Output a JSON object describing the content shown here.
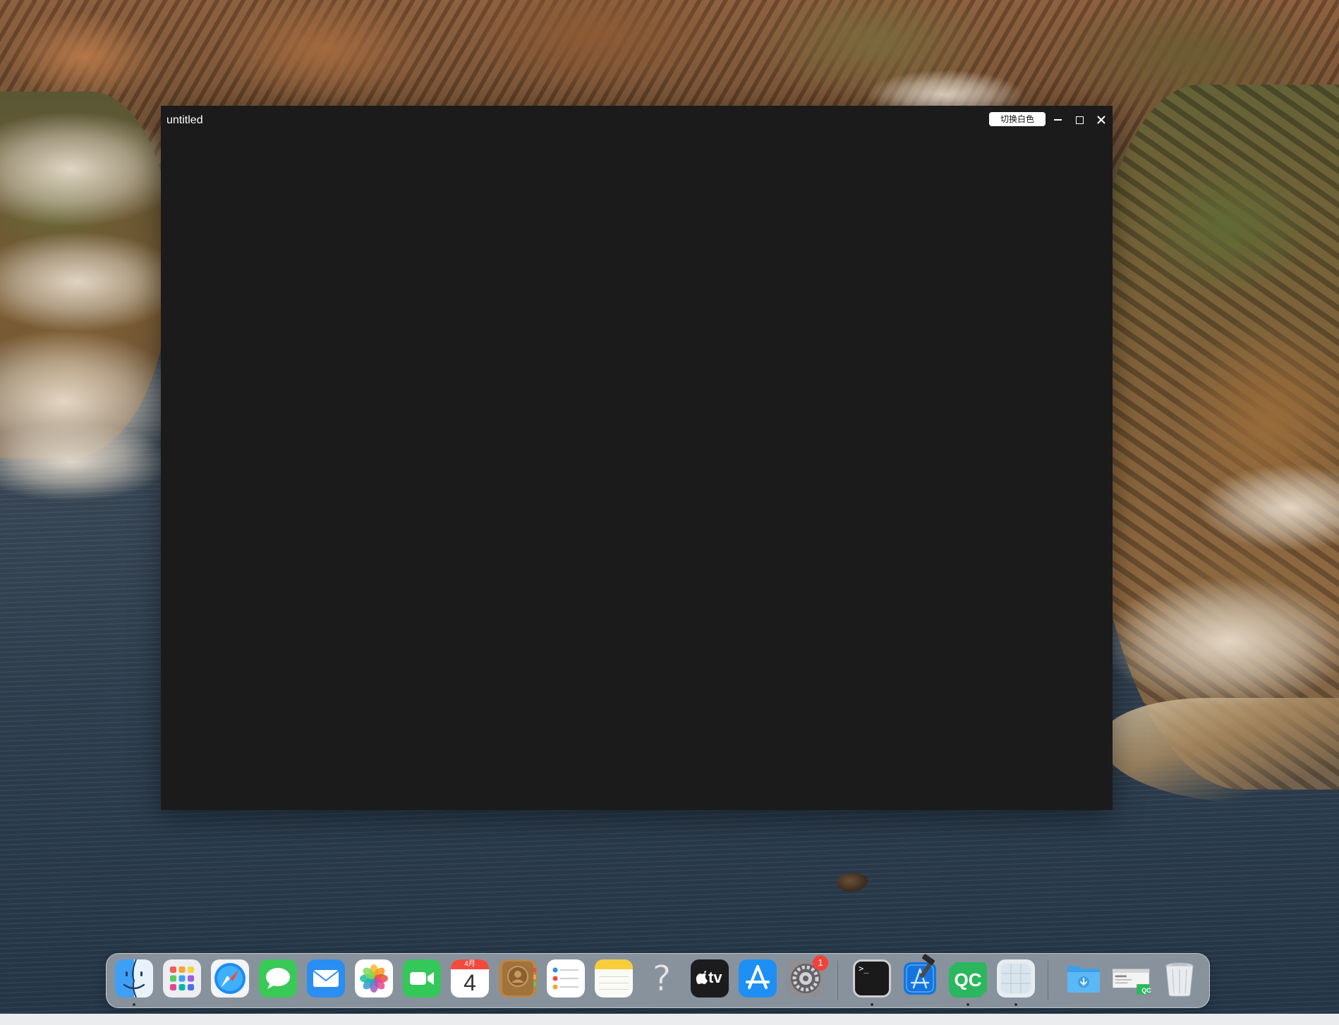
{
  "window": {
    "title": "untitled",
    "switch_theme_label": "切换白色",
    "background": "#1b1b1b"
  },
  "dock": {
    "calendar": {
      "month": "4月",
      "day": "4"
    },
    "settings_badge": "1",
    "appletv_label": "tv",
    "qc_label": "QC",
    "qc_badge": "QC",
    "terminal_prompt": ">_",
    "help_glyph": "?",
    "items": [
      "finder-icon",
      "launchpad-icon",
      "safari-icon",
      "messages-icon",
      "mail-icon",
      "photos-icon",
      "facetime-icon",
      "calendar-icon",
      "contacts-icon",
      "reminders-icon",
      "notes-icon",
      "help-icon",
      "apple-tv-icon",
      "app-store-icon",
      "system-preferences-icon",
      "terminal-icon",
      "xcode-icon",
      "qt-creator-icon",
      "preview-icon",
      "downloads-folder-icon",
      "qt-app-icon",
      "trash-icon"
    ]
  }
}
